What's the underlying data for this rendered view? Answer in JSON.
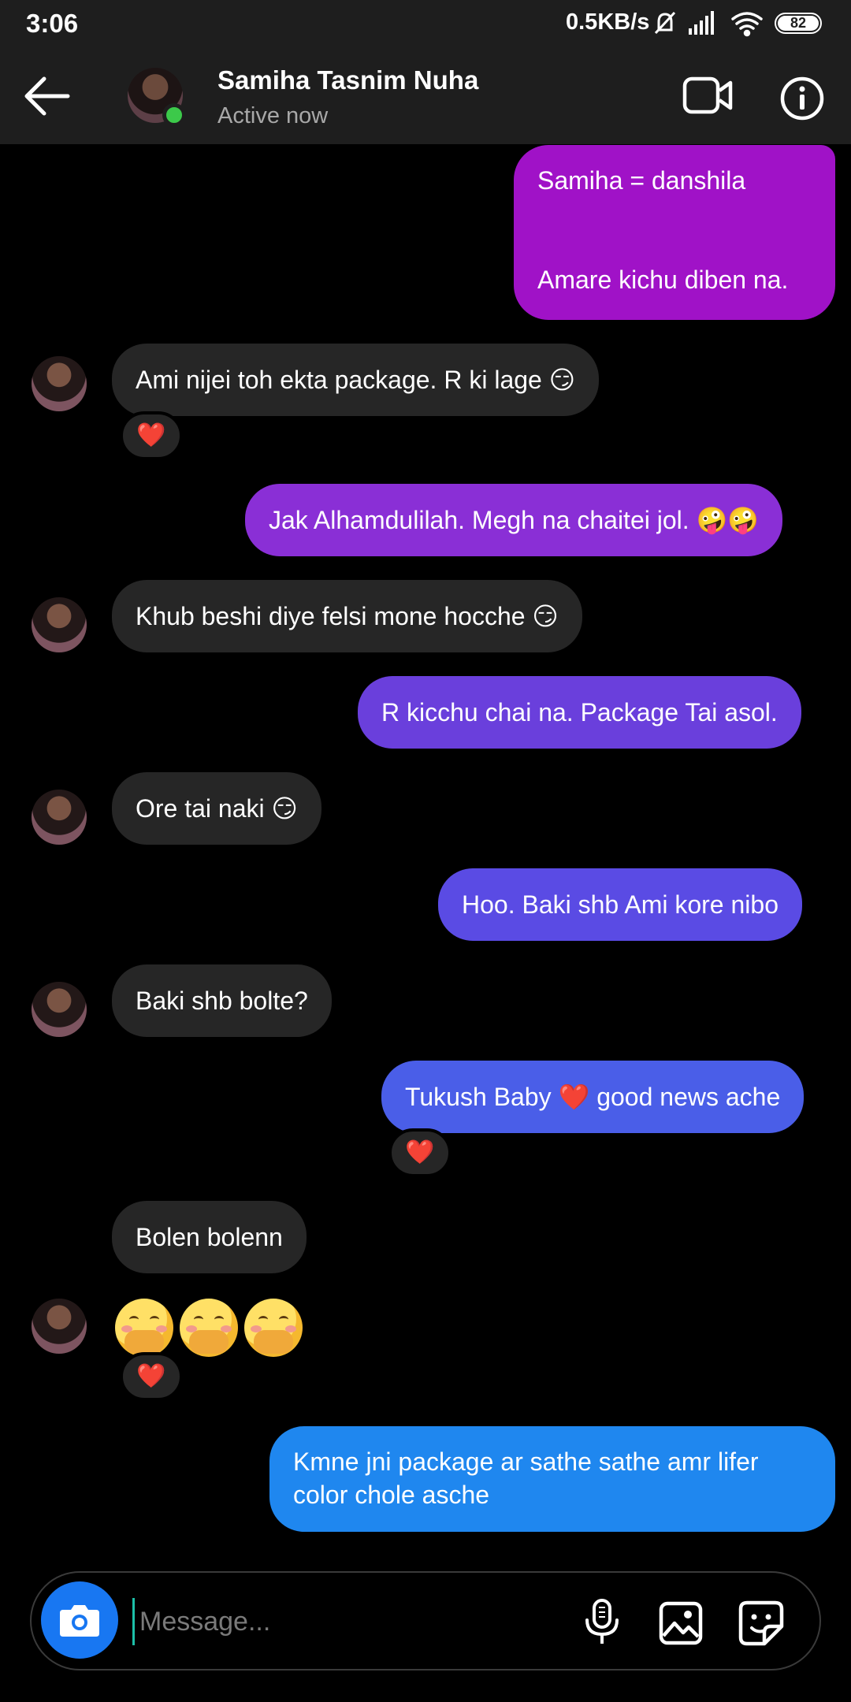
{
  "status_bar": {
    "time": "3:06",
    "network_speed": "0.5KB/s",
    "battery": "82",
    "icons": [
      "mute-icon",
      "signal-icon",
      "wifi-icon",
      "battery-icon"
    ]
  },
  "header": {
    "contact_name": "Samiha Tasnim Nuha",
    "contact_status": "Active now",
    "online_color": "#3cc94a",
    "icons": [
      "back-arrow-icon",
      "video-call-icon",
      "info-icon"
    ]
  },
  "messages": [
    {
      "from": "me",
      "lines": [
        "Samiha = danshila",
        "",
        "Amare kichu diben na."
      ],
      "color": "#a012c7"
    },
    {
      "from": "them",
      "text": "Ami nijei toh ekta package. R ki lage 😏",
      "reaction": "❤️"
    },
    {
      "from": "me",
      "text": "Jak Alhamdulilah. Megh na chaitei jol. 🤪🤪",
      "color": "#8a2fd6"
    },
    {
      "from": "them",
      "text": "Khub beshi diye felsi mone hocche 😏"
    },
    {
      "from": "me",
      "text": "R kicchu chai na. Package Tai asol.",
      "color": "#6a3fdc"
    },
    {
      "from": "them",
      "text": "Ore tai naki 😏"
    },
    {
      "from": "me",
      "text": "Hoo. Baki shb Ami kore nibo",
      "color": "#5a4be4"
    },
    {
      "from": "them",
      "text": "Baki shb bolte?"
    },
    {
      "from": "me",
      "text": "Tukush Baby ❤️ good news ache",
      "color": "#4a5ee8",
      "reaction": "❤️"
    },
    {
      "from": "them",
      "text": "Bolen bolenn"
    },
    {
      "from": "them",
      "text": "🤭🤭🤭",
      "reaction": "❤️"
    },
    {
      "from": "me",
      "lines": [
        "Kmne jni package ar sathe sathe amr lifer",
        "color chole asche"
      ],
      "color": "#1f87ef"
    }
  ],
  "composer": {
    "placeholder": "Message...",
    "camera_color": "#1877f2",
    "icons": [
      "camera-icon",
      "microphone-icon",
      "gallery-icon",
      "sticker-icon"
    ]
  }
}
